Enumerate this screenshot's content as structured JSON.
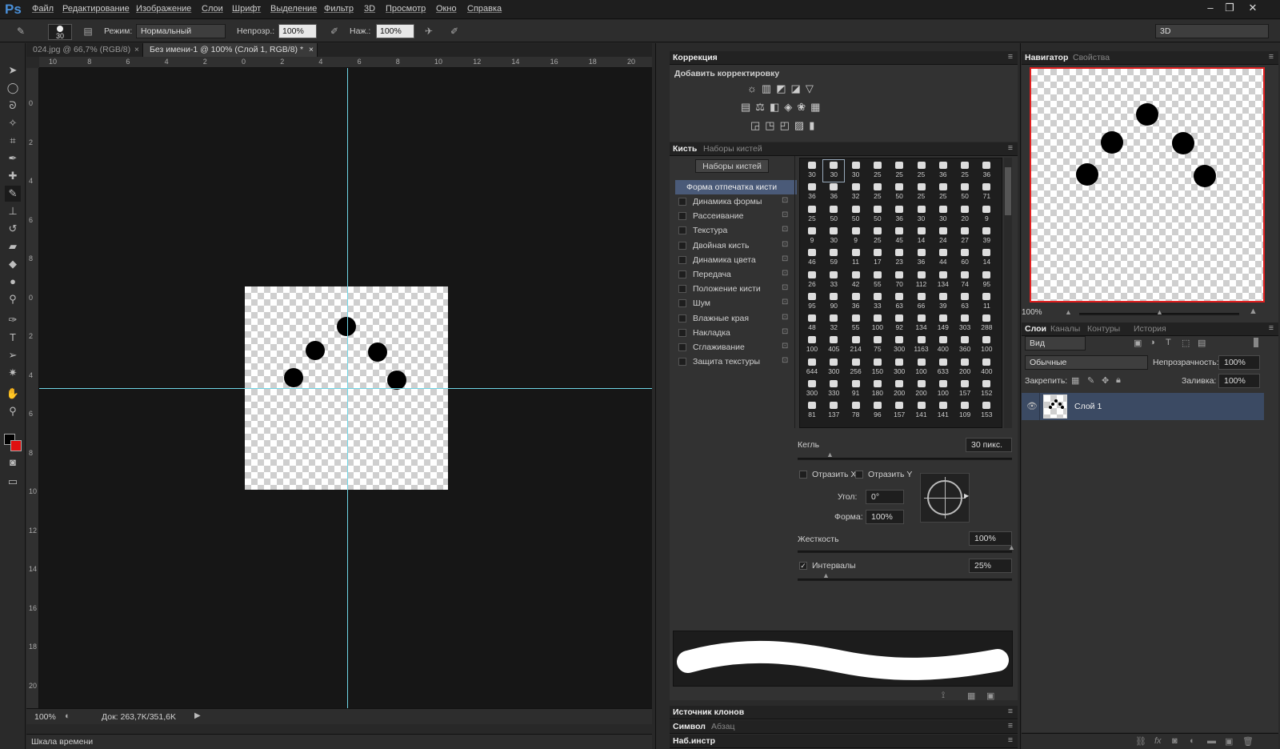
{
  "app": {
    "logo": "Ps"
  },
  "menu": [
    "Файл",
    "Редактирование",
    "Изображение",
    "Слои",
    "Шрифт",
    "Выделение",
    "Фильтр",
    "3D",
    "Просмотр",
    "Окно",
    "Справка"
  ],
  "window_buttons": [
    "–",
    "❐",
    "✕"
  ],
  "options": {
    "brush_size": "30",
    "mode_label": "Режим:",
    "mode_value": "Нормальный",
    "opacity_label": "Непрозр.:",
    "opacity_value": "100%",
    "pressure_label": "Наж.:",
    "pressure_value": "100%",
    "workspace": "3D"
  },
  "doc_tabs": [
    {
      "label": "024.jpg @ 66,7% (RGB/8)"
    },
    {
      "label": "Без имени-1 @ 100% (Слой 1, RGB/8) *"
    }
  ],
  "ruler_h": [
    "10",
    "8",
    "6",
    "4",
    "2",
    "0",
    "2",
    "4",
    "6",
    "8",
    "10",
    "12",
    "14",
    "16",
    "18",
    "20"
  ],
  "ruler_v": [
    "0",
    "2",
    "4",
    "6",
    "8",
    "0",
    "2",
    "4",
    "6",
    "8",
    "10",
    "12",
    "14",
    "16",
    "18",
    "20"
  ],
  "status": {
    "zoom": "100%",
    "doc": "Док: 263,7K/351,6K"
  },
  "timeline_label": "Шкала времени",
  "adjustments": {
    "title": "Коррекция",
    "add_label": "Добавить корректировку",
    "icons_row1": [
      "☼",
      "▥",
      "◩",
      "◪",
      "▽"
    ],
    "icons_row2": [
      "▤",
      "⚖",
      "◧",
      "◈",
      "❀",
      "▦"
    ],
    "icons_row3": [
      "◲",
      "◳",
      "◰",
      "▨",
      "▮"
    ]
  },
  "brush_panel": {
    "tabs": [
      "Кисть",
      "Наборы кистей"
    ],
    "presets_button": "Наборы кистей",
    "selected_option": "Форма отпечатка кисти",
    "options": [
      "Динамика формы",
      "Рассеивание",
      "Текстура",
      "Двойная кисть",
      "Динамика цвета",
      "Передача",
      "Положение кисти",
      "Шум",
      "Влажные края",
      "Накладка",
      "Сглаживание",
      "Защита текстуры"
    ],
    "tip_sizes": [
      [
        "30",
        "30",
        "30",
        "25",
        "25",
        "25",
        "36",
        "25",
        "36"
      ],
      [
        "36",
        "36",
        "32",
        "25",
        "50",
        "25",
        "25",
        "50",
        "71"
      ],
      [
        "25",
        "50",
        "50",
        "50",
        "36",
        "30",
        "30",
        "20",
        "9"
      ],
      [
        "9",
        "30",
        "9",
        "25",
        "45",
        "14",
        "24",
        "27",
        "39"
      ],
      [
        "46",
        "59",
        "11",
        "17",
        "23",
        "36",
        "44",
        "60",
        "14"
      ],
      [
        "26",
        "33",
        "42",
        "55",
        "70",
        "112",
        "134",
        "74",
        "95"
      ],
      [
        "95",
        "90",
        "36",
        "33",
        "63",
        "66",
        "39",
        "63",
        "11"
      ],
      [
        "48",
        "32",
        "55",
        "100",
        "92",
        "134",
        "149",
        "303",
        "288"
      ],
      [
        "100",
        "405",
        "214",
        "75",
        "300",
        "1163",
        "400",
        "360",
        "100"
      ],
      [
        "644",
        "300",
        "256",
        "150",
        "300",
        "100",
        "633",
        "200",
        "400"
      ],
      [
        "300",
        "330",
        "91",
        "180",
        "200",
        "200",
        "100",
        "157",
        "152"
      ],
      [
        "81",
        "137",
        "78",
        "96",
        "157",
        "141",
        "141",
        "109",
        "153"
      ]
    ],
    "size_label": "Кегль",
    "size_value": "30 пикс.",
    "flip_x": "Отразить X",
    "flip_y": "Отразить Y",
    "angle_label": "Угол:",
    "angle_value": "0°",
    "roundness_label": "Форма:",
    "roundness_value": "100%",
    "hardness_label": "Жесткость",
    "hardness_value": "100%",
    "spacing_label": "Интервалы",
    "spacing_value": "25%"
  },
  "collapsed_panels": [
    "Источник клонов",
    "Наб.инстр"
  ],
  "symbol_tabs": [
    "Символ",
    "Абзац"
  ],
  "navigator": {
    "tabs": [
      "Навигатор",
      "Свойства"
    ],
    "zoom": "100%"
  },
  "layers": {
    "tabs": [
      "Слои",
      "Каналы",
      "Контуры",
      "История"
    ],
    "filter": "Вид",
    "blend_mode": "Обычные",
    "opacity_label": "Непрозрачность:",
    "opacity_value": "100%",
    "lock_label": "Закрепить:",
    "fill_label": "Заливка:",
    "fill_value": "100%",
    "layer_name": "Слой 1"
  },
  "colors": {
    "foreground": "#000000",
    "background": "#e01010",
    "accent": "#4a90d9",
    "guide": "#6fd6e6"
  }
}
